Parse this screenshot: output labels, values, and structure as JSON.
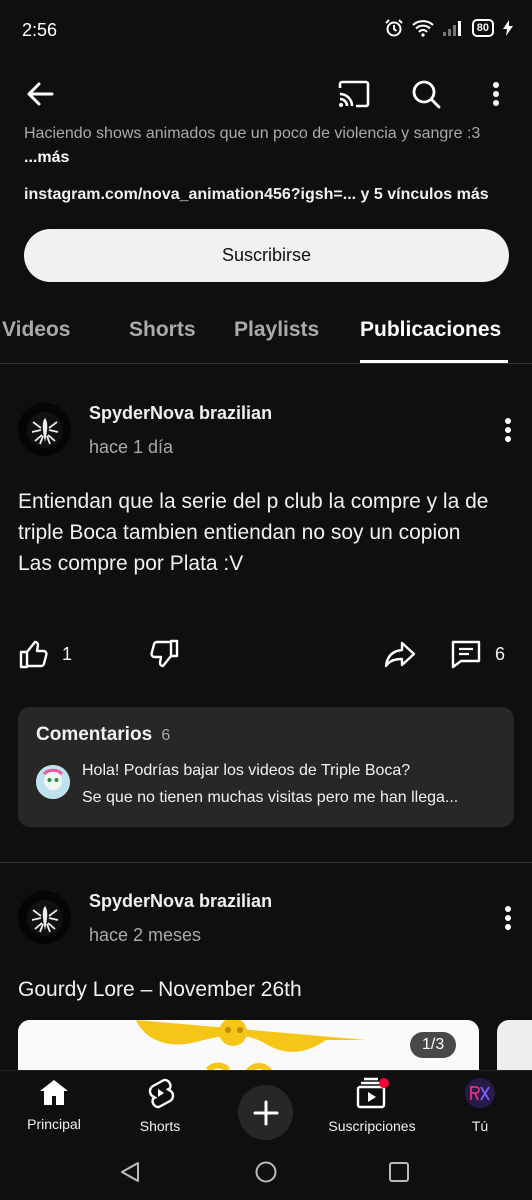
{
  "status": {
    "time": "2:56",
    "battery": "80"
  },
  "channel": {
    "description": "Haciendo shows animados que un poco de violencia y sangre :3",
    "more": "...más",
    "links": "instagram.com/nova_animation456?igsh=... y 5 vínculos más",
    "subscribe_label": "Suscribirse"
  },
  "tabs": [
    {
      "label": "Videos"
    },
    {
      "label": "Shorts"
    },
    {
      "label": "Playlists"
    },
    {
      "label": "Publicaciones"
    }
  ],
  "posts": [
    {
      "author": "SpyderNova brazilian",
      "time": "hace 1 día",
      "text": "Entiendan que la serie del p club la compre y la de triple Boca tambien entiendan no soy un copion\nLas compre por Plata :V",
      "likes": "1",
      "comments": "6",
      "comments_section": {
        "title": "Comentarios",
        "count": "6",
        "preview_line1": "Hola! Podrías bajar los videos de Triple Boca?",
        "preview_line2": "Se que no tienen muchas visitas pero me han llega..."
      }
    },
    {
      "author": "SpyderNova brazilian",
      "time": "hace 2 meses",
      "text": "Gourdy Lore – November 26th",
      "image_counter": "1/3"
    }
  ],
  "bottom_nav": [
    {
      "label": "Principal"
    },
    {
      "label": "Shorts"
    },
    {
      "label": "Suscripciones"
    },
    {
      "label": "Tú"
    }
  ],
  "colors": {
    "background": "#0f0f0f",
    "notification_dot": "#ff0033",
    "subscribe_bg": "#f1f1f1"
  }
}
